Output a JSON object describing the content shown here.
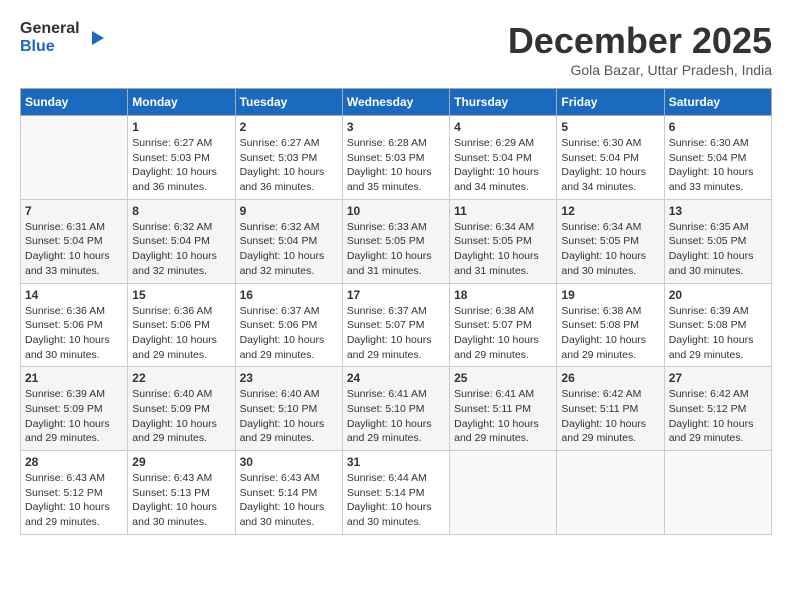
{
  "header": {
    "logo_line1": "General",
    "logo_line2": "Blue",
    "month": "December 2025",
    "location": "Gola Bazar, Uttar Pradesh, India"
  },
  "columns": [
    "Sunday",
    "Monday",
    "Tuesday",
    "Wednesday",
    "Thursday",
    "Friday",
    "Saturday"
  ],
  "weeks": [
    [
      {
        "day": "",
        "info": ""
      },
      {
        "day": "1",
        "info": "Sunrise: 6:27 AM\nSunset: 5:03 PM\nDaylight: 10 hours and 36 minutes."
      },
      {
        "day": "2",
        "info": "Sunrise: 6:27 AM\nSunset: 5:03 PM\nDaylight: 10 hours and 36 minutes."
      },
      {
        "day": "3",
        "info": "Sunrise: 6:28 AM\nSunset: 5:03 PM\nDaylight: 10 hours and 35 minutes."
      },
      {
        "day": "4",
        "info": "Sunrise: 6:29 AM\nSunset: 5:04 PM\nDaylight: 10 hours and 34 minutes."
      },
      {
        "day": "5",
        "info": "Sunrise: 6:30 AM\nSunset: 5:04 PM\nDaylight: 10 hours and 34 minutes."
      },
      {
        "day": "6",
        "info": "Sunrise: 6:30 AM\nSunset: 5:04 PM\nDaylight: 10 hours and 33 minutes."
      }
    ],
    [
      {
        "day": "7",
        "info": "Sunrise: 6:31 AM\nSunset: 5:04 PM\nDaylight: 10 hours and 33 minutes."
      },
      {
        "day": "8",
        "info": "Sunrise: 6:32 AM\nSunset: 5:04 PM\nDaylight: 10 hours and 32 minutes."
      },
      {
        "day": "9",
        "info": "Sunrise: 6:32 AM\nSunset: 5:04 PM\nDaylight: 10 hours and 32 minutes."
      },
      {
        "day": "10",
        "info": "Sunrise: 6:33 AM\nSunset: 5:05 PM\nDaylight: 10 hours and 31 minutes."
      },
      {
        "day": "11",
        "info": "Sunrise: 6:34 AM\nSunset: 5:05 PM\nDaylight: 10 hours and 31 minutes."
      },
      {
        "day": "12",
        "info": "Sunrise: 6:34 AM\nSunset: 5:05 PM\nDaylight: 10 hours and 30 minutes."
      },
      {
        "day": "13",
        "info": "Sunrise: 6:35 AM\nSunset: 5:05 PM\nDaylight: 10 hours and 30 minutes."
      }
    ],
    [
      {
        "day": "14",
        "info": "Sunrise: 6:36 AM\nSunset: 5:06 PM\nDaylight: 10 hours and 30 minutes."
      },
      {
        "day": "15",
        "info": "Sunrise: 6:36 AM\nSunset: 5:06 PM\nDaylight: 10 hours and 29 minutes."
      },
      {
        "day": "16",
        "info": "Sunrise: 6:37 AM\nSunset: 5:06 PM\nDaylight: 10 hours and 29 minutes."
      },
      {
        "day": "17",
        "info": "Sunrise: 6:37 AM\nSunset: 5:07 PM\nDaylight: 10 hours and 29 minutes."
      },
      {
        "day": "18",
        "info": "Sunrise: 6:38 AM\nSunset: 5:07 PM\nDaylight: 10 hours and 29 minutes."
      },
      {
        "day": "19",
        "info": "Sunrise: 6:38 AM\nSunset: 5:08 PM\nDaylight: 10 hours and 29 minutes."
      },
      {
        "day": "20",
        "info": "Sunrise: 6:39 AM\nSunset: 5:08 PM\nDaylight: 10 hours and 29 minutes."
      }
    ],
    [
      {
        "day": "21",
        "info": "Sunrise: 6:39 AM\nSunset: 5:09 PM\nDaylight: 10 hours and 29 minutes."
      },
      {
        "day": "22",
        "info": "Sunrise: 6:40 AM\nSunset: 5:09 PM\nDaylight: 10 hours and 29 minutes."
      },
      {
        "day": "23",
        "info": "Sunrise: 6:40 AM\nSunset: 5:10 PM\nDaylight: 10 hours and 29 minutes."
      },
      {
        "day": "24",
        "info": "Sunrise: 6:41 AM\nSunset: 5:10 PM\nDaylight: 10 hours and 29 minutes."
      },
      {
        "day": "25",
        "info": "Sunrise: 6:41 AM\nSunset: 5:11 PM\nDaylight: 10 hours and 29 minutes."
      },
      {
        "day": "26",
        "info": "Sunrise: 6:42 AM\nSunset: 5:11 PM\nDaylight: 10 hours and 29 minutes."
      },
      {
        "day": "27",
        "info": "Sunrise: 6:42 AM\nSunset: 5:12 PM\nDaylight: 10 hours and 29 minutes."
      }
    ],
    [
      {
        "day": "28",
        "info": "Sunrise: 6:43 AM\nSunset: 5:12 PM\nDaylight: 10 hours and 29 minutes."
      },
      {
        "day": "29",
        "info": "Sunrise: 6:43 AM\nSunset: 5:13 PM\nDaylight: 10 hours and 30 minutes."
      },
      {
        "day": "30",
        "info": "Sunrise: 6:43 AM\nSunset: 5:14 PM\nDaylight: 10 hours and 30 minutes."
      },
      {
        "day": "31",
        "info": "Sunrise: 6:44 AM\nSunset: 5:14 PM\nDaylight: 10 hours and 30 minutes."
      },
      {
        "day": "",
        "info": ""
      },
      {
        "day": "",
        "info": ""
      },
      {
        "day": "",
        "info": ""
      }
    ]
  ]
}
